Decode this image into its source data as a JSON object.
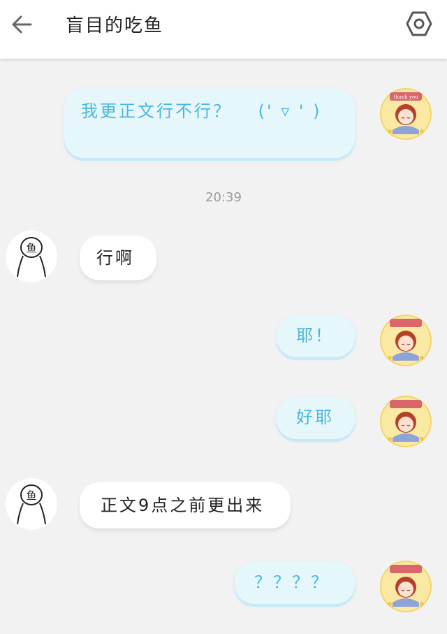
{
  "header": {
    "title": "盲目的吃鱼",
    "back_icon": "arrow-left-icon",
    "settings_icon": "hexagon-settings-icon"
  },
  "timestamp": "20:39",
  "messages": [
    {
      "side": "out",
      "text": "我更正文行不行？ 　(' ▿ ' )"
    },
    {
      "side": "in",
      "text": "行啊"
    },
    {
      "side": "out",
      "text": "耶！"
    },
    {
      "side": "out",
      "text": "好耶"
    },
    {
      "side": "in",
      "text": "正文9点之前更出来"
    },
    {
      "side": "out",
      "text": "？？？？"
    }
  ],
  "avatars": {
    "me_badge_text": "thank you",
    "them_char": "鱼"
  },
  "colors": {
    "out_bubble_bg": "#e6f7fb",
    "out_text": "#4ab7dc",
    "in_bubble_bg": "#ffffff"
  }
}
